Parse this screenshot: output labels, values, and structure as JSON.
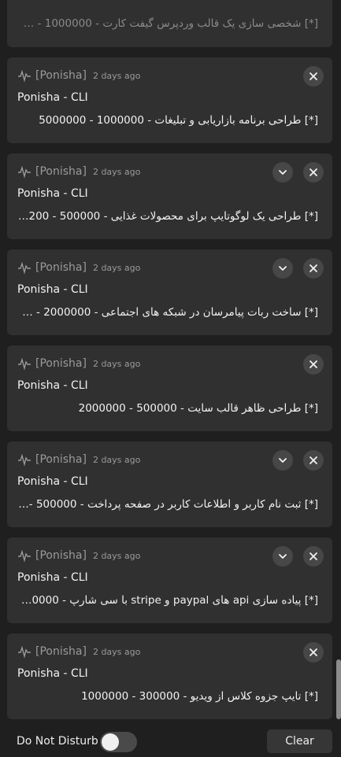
{
  "notifications": [
    {
      "app": "[Ponisha]",
      "time": "2 days ago",
      "title": "Ponisha - CLI",
      "body": "[*] شخصی سازی یک قالب وردپرس گیفت کارت - 1000000 - …",
      "expandable": false
    },
    {
      "app": "[Ponisha]",
      "time": "2 days ago",
      "title": "Ponisha - CLI",
      "body": "[*] طراحی برنامه بازاریابی و تبلیغات - 1000000 - 5000000",
      "expandable": false
    },
    {
      "app": "[Ponisha]",
      "time": "2 days ago",
      "title": "Ponisha - CLI",
      "body": "[*] طراحی یک لوگوتایپ برای محصولات غذایی - 500000 - 200…",
      "expandable": true
    },
    {
      "app": "[Ponisha]",
      "time": "2 days ago",
      "title": "Ponisha - CLI",
      "body": "[*] ساخت ربات پیامرسان در شبکه های اجتماعی - 2000000 - 4…",
      "expandable": true
    },
    {
      "app": "[Ponisha]",
      "time": "2 days ago",
      "title": "Ponisha - CLI",
      "body": "[*] طراحی ظاهر قالب سایت - 500000 - 2000000",
      "expandable": false
    },
    {
      "app": "[Ponisha]",
      "time": "2 days ago",
      "title": "Ponisha - CLI",
      "body": "[*] ثبت نام کاربر و اطلاعات کاربر در صفحه پرداخت - 500000 - 7…",
      "expandable": true
    },
    {
      "app": "[Ponisha]",
      "time": "2 days ago",
      "title": "Ponisha - CLI",
      "body": "[*] پیاده سازی api های paypal و stripe با سی شارپ - 20000 …",
      "expandable": true
    },
    {
      "app": "[Ponisha]",
      "time": "2 days ago",
      "title": "Ponisha - CLI",
      "body": "[*] تایپ جزوه کلاس از ویدیو - 300000 - 1000000",
      "expandable": false
    }
  ],
  "footer": {
    "dnd_label": "Do Not Disturb",
    "dnd_enabled": false,
    "clear_label": "Clear"
  },
  "icons": {
    "app": "ponisha-app-icon",
    "close": "close-icon",
    "expand": "chevron-down-icon"
  },
  "colors": {
    "background": "#1f1f1f",
    "card": "#303030",
    "button": "#474747"
  }
}
